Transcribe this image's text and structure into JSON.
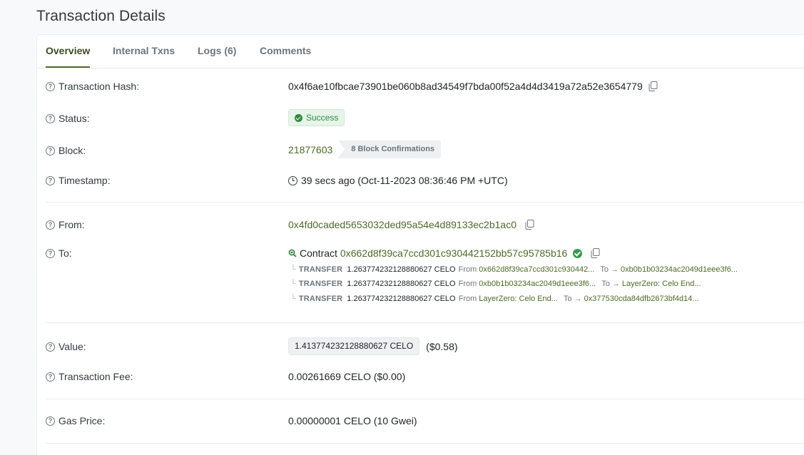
{
  "page": {
    "title": "Transaction Details"
  },
  "tabs": [
    {
      "label": "Overview"
    },
    {
      "label": "Internal Txns"
    },
    {
      "label": "Logs (6)"
    },
    {
      "label": "Comments"
    }
  ],
  "tx": {
    "hash_label": "Transaction Hash:",
    "hash": "0x4f6ae10fbcae73901be060b8ad34549f7bda00f52a4d4d3419a72a52e3654779",
    "status_label": "Status:",
    "status": "Success",
    "block_label": "Block:",
    "block": "21877603",
    "confirmations": "8 Block Confirmations",
    "timestamp_label": "Timestamp:",
    "timestamp": "39 secs ago (Oct-11-2023 08:36:46 PM +UTC)",
    "from_label": "From:",
    "from": "0x4fd0caded5653032ded95a54e4d89133ec2b1ac0",
    "to_label": "To:",
    "to_prefix": "Contract",
    "to": "0x662d8f39ca7ccd301c930442152bb57c95785b16",
    "transfers": [
      {
        "type": "TRANSFER",
        "amount": "1.263774232128880627 CELO",
        "from_text": "From",
        "from": "0x662d8f39ca7ccd301c930442...",
        "to_text": "To →",
        "to": "0xb0b1b03234ac2049d1eee3f6..."
      },
      {
        "type": "TRANSFER",
        "amount": "1.263774232128880627 CELO",
        "from_text": "From",
        "from": "0xb0b1b03234ac2049d1eee3f6...",
        "to_text": "To →",
        "to": "LayerZero: Celo End..."
      },
      {
        "type": "TRANSFER",
        "amount": "1.263774232128880627 CELO",
        "from_text": "From",
        "from": "LayerZero: Celo End...",
        "to_text": "To →",
        "to": "0x377530cda84dfb2673bf4d14..."
      }
    ],
    "value_label": "Value:",
    "value": "1.413774232128880627 CELO",
    "value_usd": "($0.58)",
    "fee_label": "Transaction Fee:",
    "fee": "0.00261669 CELO ($0.00)",
    "gas_label": "Gas Price:",
    "gas": "0.00000001 CELO (10 Gwei)"
  },
  "icons": {
    "help": "?",
    "tree": "└"
  },
  "colors": {
    "accent": "#4e6a26",
    "success": "#2f8a3e"
  }
}
